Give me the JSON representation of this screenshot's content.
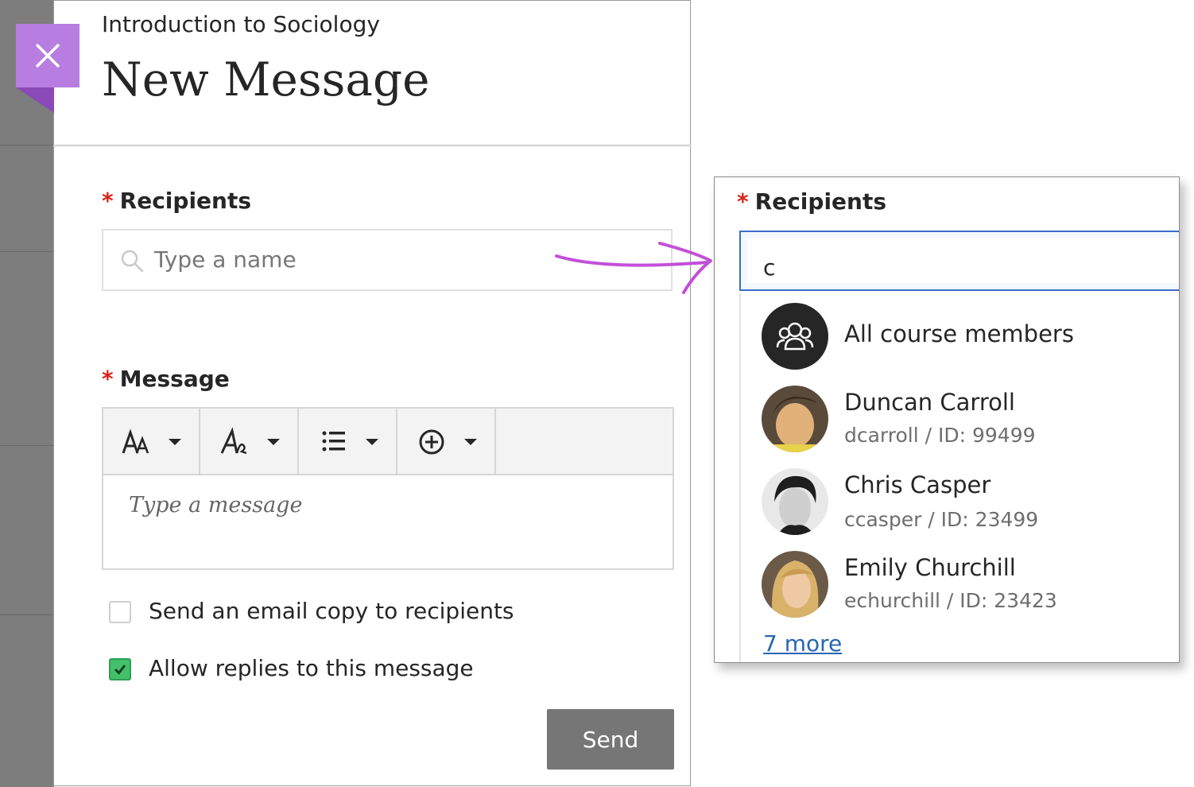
{
  "panel": {
    "course_name": "Introduction to Sociology",
    "title": "New Message",
    "close_label": "×"
  },
  "recipients": {
    "label": "Recipients",
    "required_mark": "*",
    "placeholder": "Type a name"
  },
  "message": {
    "label": "Message",
    "required_mark": "*",
    "placeholder": "Type a message",
    "toolbar": [
      {
        "name": "text-size",
        "icon": "font-size-icon"
      },
      {
        "name": "text-style",
        "icon": "font-style-icon"
      },
      {
        "name": "list",
        "icon": "list-icon"
      },
      {
        "name": "insert",
        "icon": "plus-circle-icon"
      }
    ]
  },
  "options": [
    {
      "label": "Send an email copy to recipients",
      "checked": false
    },
    {
      "label": "Allow replies to this message",
      "checked": true
    }
  ],
  "send_label": "Send",
  "dropdown": {
    "label": "Recipients",
    "required_mark": "*",
    "query": "c",
    "items": [
      {
        "name": "All course members",
        "sub": "",
        "icon": "group-icon"
      },
      {
        "name": "Duncan Carroll",
        "sub": "dcarroll / ID: 99499"
      },
      {
        "name": "Chris Casper",
        "sub": "ccasper / ID: 23499"
      },
      {
        "name": "Emily Churchill",
        "sub": "echurchill / ID: 23423"
      }
    ],
    "more_label": "7 more"
  },
  "colors": {
    "accent_purple": "#b77de0",
    "required_red": "#d8241c",
    "checkbox_green": "#43c06a",
    "link_blue": "#2867b2",
    "annotation_arrow": "#c34fd8"
  }
}
